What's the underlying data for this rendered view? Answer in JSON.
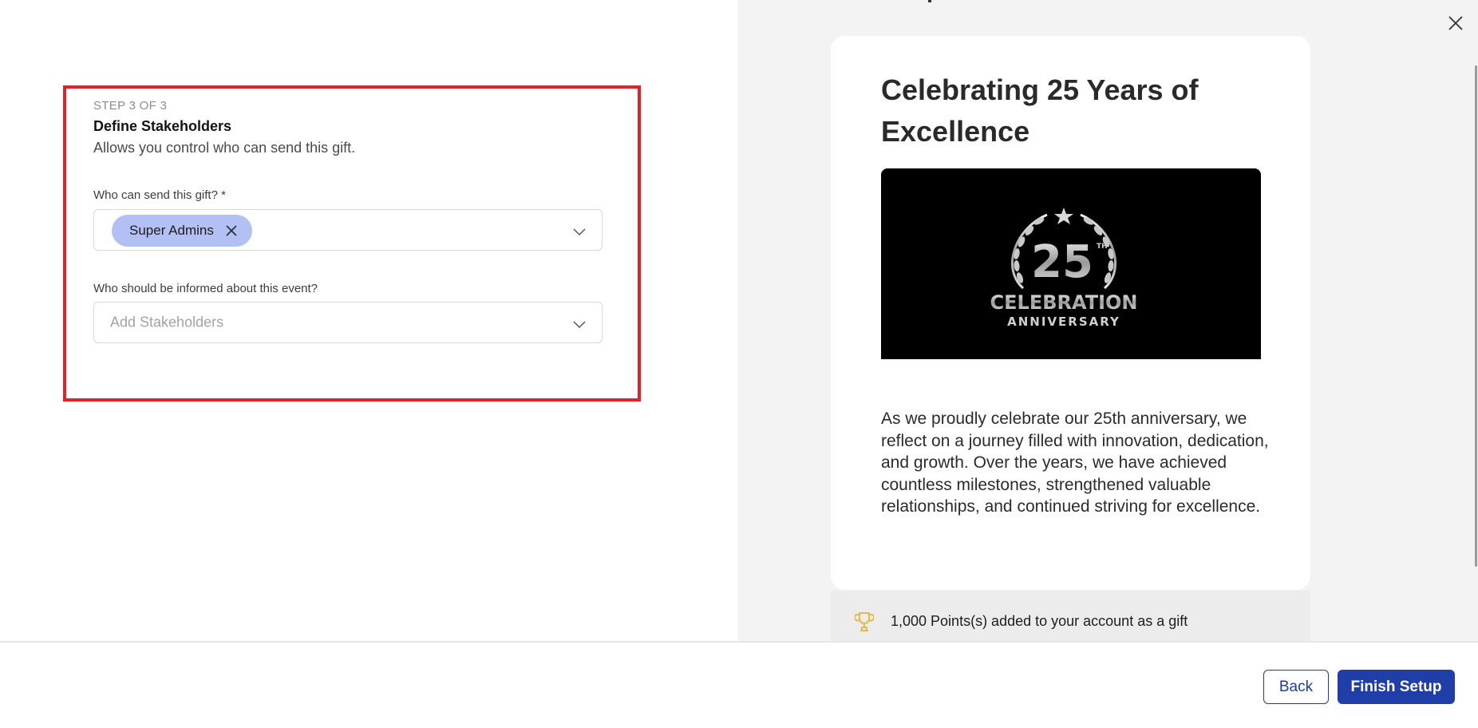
{
  "step": {
    "label": "STEP 3 OF 3",
    "title": "Define Stakeholders",
    "description": "Allows you control who can send this gift."
  },
  "senders_field": {
    "label": "Who can send this gift? *",
    "selected": [
      "Super Admins"
    ]
  },
  "stakeholders_field": {
    "label": "Who should be informed about this event?",
    "placeholder": "Add Stakeholders"
  },
  "preview": {
    "title": "Celebrating 25 Years of Excellence",
    "image": {
      "number": "25",
      "superscript": "TH",
      "line1": "CELEBRATION",
      "line2": "ANNIVERSARY"
    },
    "body": "As we proudly celebrate our 25th anniversary, we reflect on a journey filled with innovation, dedication, and growth. Over the years, we have achieved countless milestones, strengthened valuable relationships, and continued striving for excellence.",
    "points_text": "1,000 Points(s) added to your account as a gift"
  },
  "footer": {
    "back_label": "Back",
    "finish_label": "Finish Setup"
  },
  "colors": {
    "primary": "#1f3ea8",
    "chip": "#b3c0f3",
    "highlight": "#e12328",
    "trophy": "#e8b84a"
  },
  "icons": {
    "close": "close-icon",
    "chevron": "chevron-down-icon",
    "chip_remove": "remove-icon",
    "trophy": "trophy-icon"
  }
}
